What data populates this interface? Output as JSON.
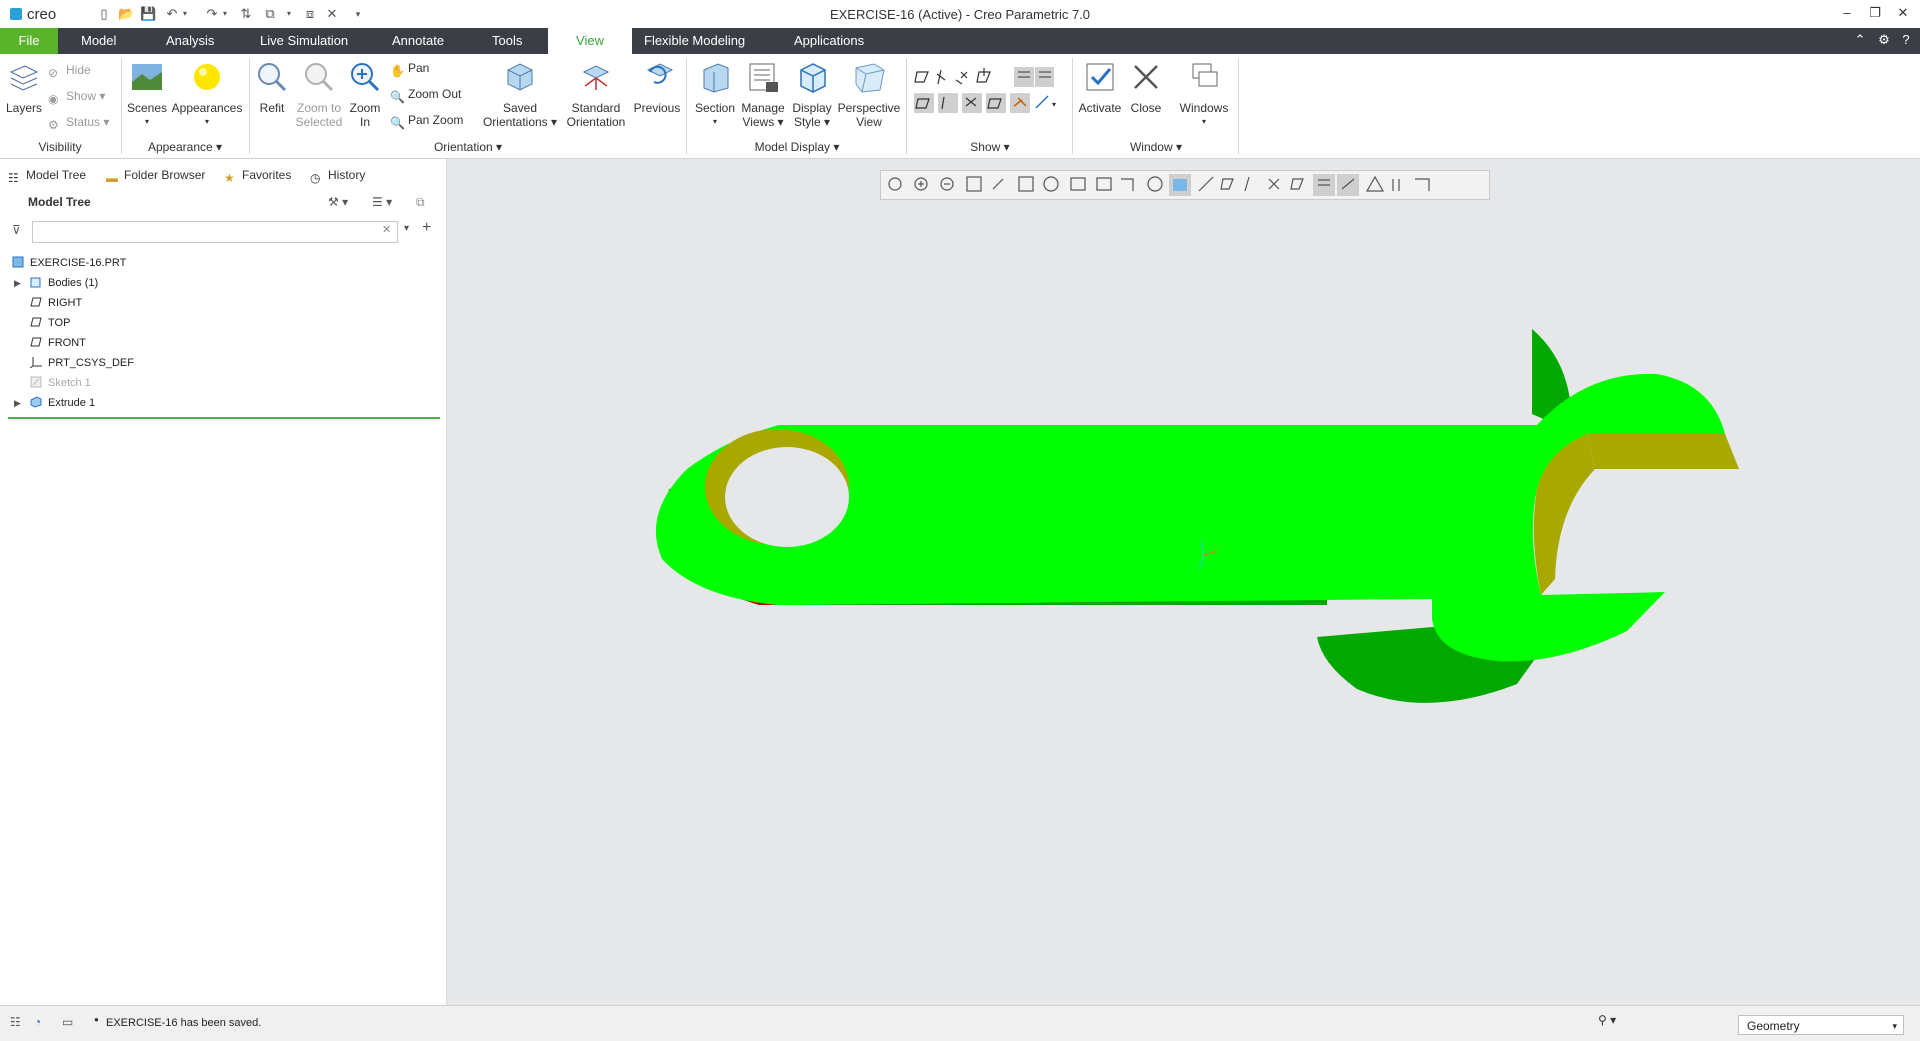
{
  "app": {
    "logo": "creo",
    "window_title": "EXERCISE-16 (Active) - Creo Parametric 7.0"
  },
  "tabs": [
    "File",
    "Model",
    "Analysis",
    "Live Simulation",
    "Annotate",
    "Tools",
    "View",
    "Flexible Modeling",
    "Applications"
  ],
  "active_tab": "View",
  "ribbon": {
    "visibility": {
      "label": "Visibility",
      "layers": "Layers",
      "hide": "Hide",
      "show": "Show",
      "status": "Status"
    },
    "appearance": {
      "label": "Appearance",
      "scenes": "Scenes",
      "appearances": "Appearances"
    },
    "orientation": {
      "label": "Orientation",
      "refit": "Refit",
      "zoom_to_selected_1": "Zoom to",
      "zoom_to_selected_2": "Selected",
      "zoom_in_1": "Zoom",
      "zoom_in_2": "In",
      "pan": "Pan",
      "zoom_out": "Zoom Out",
      "pan_zoom": "Pan Zoom",
      "saved_1": "Saved",
      "saved_2": "Orientations",
      "standard_1": "Standard",
      "standard_2": "Orientation",
      "previous": "Previous"
    },
    "model_display": {
      "label": "Model Display",
      "section": "Section",
      "manage_1": "Manage",
      "manage_2": "Views",
      "display_1": "Display",
      "display_2": "Style",
      "perspective_1": "Perspective",
      "perspective_2": "View"
    },
    "show": {
      "label": "Show"
    },
    "window": {
      "label": "Window",
      "activate": "Activate",
      "close": "Close",
      "windows": "Windows"
    }
  },
  "panel_tabs": {
    "model_tree": "Model Tree",
    "folder_browser": "Folder Browser",
    "favorites": "Favorites",
    "history": "History"
  },
  "model_tree": {
    "header": "Model Tree",
    "items": [
      {
        "label": "EXERCISE-16.PRT",
        "icon": "part-icon"
      },
      {
        "label": "Bodies (1)",
        "icon": "bodies-icon"
      },
      {
        "label": "RIGHT",
        "icon": "datum-plane-icon"
      },
      {
        "label": "TOP",
        "icon": "datum-plane-icon"
      },
      {
        "label": "FRONT",
        "icon": "datum-plane-icon"
      },
      {
        "label": "PRT_CSYS_DEF",
        "icon": "csys-icon"
      },
      {
        "label": "Sketch 1",
        "icon": "sketch-icon"
      },
      {
        "label": "Extrude 1",
        "icon": "extrude-icon"
      }
    ]
  },
  "status": {
    "message": "EXERCISE-16 has been saved.",
    "filter_value": "Geometry"
  },
  "colors": {
    "tabbar": "#3b3f45",
    "file_tab": "#59b32b",
    "active_tab_text": "#3aa53a",
    "part_top": "#00ff00",
    "part_side": "#00a800",
    "part_inner": "#a8a800",
    "part_red": "#c00000",
    "viewport": "#e6e7e9"
  }
}
